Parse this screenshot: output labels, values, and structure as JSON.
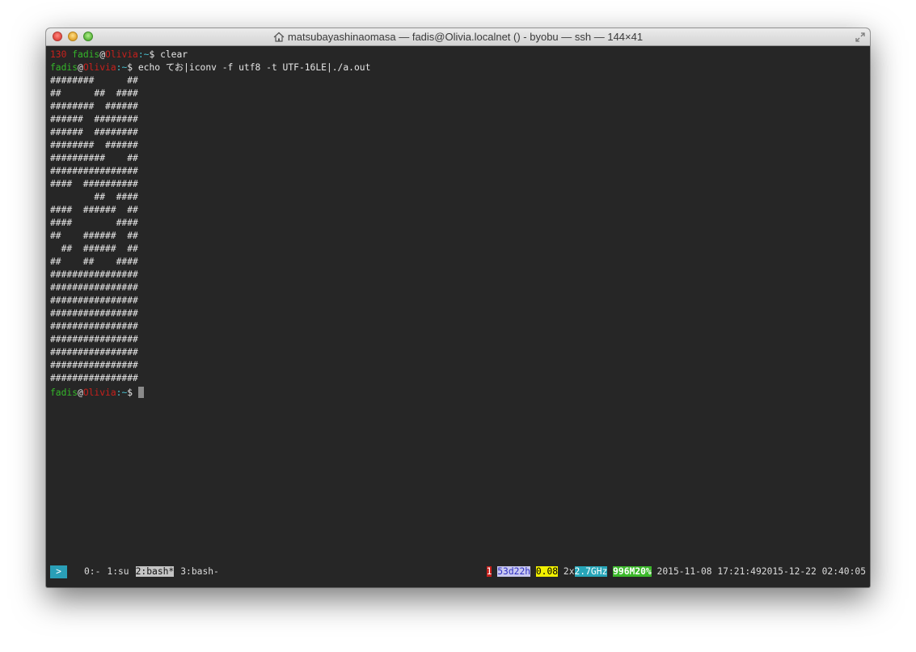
{
  "window": {
    "title": "matsubayashinaomasa — fadis@Olivia.localnet () - byobu — ssh — 144×41"
  },
  "terminal": {
    "line1": {
      "exit_code": "130",
      "user": "fadis",
      "at": "@",
      "host": "Olivia",
      "path": ":~",
      "sym": "$ ",
      "cmd": "clear"
    },
    "line2": {
      "user": "fadis",
      "at": "@",
      "host": "Olivia",
      "path": ":~",
      "sym": "$ ",
      "cmd": "echo てお|iconv -f utf8 -t UTF-16LE|./a.out"
    },
    "output": [
      "########      ##",
      "##      ##  ####",
      "########  ######",
      "######  ########",
      "######  ########",
      "########  ######",
      "##########    ##",
      "################",
      "####  ##########",
      "        ##  ####",
      "####  ######  ##",
      "####        ####",
      "##    ######  ##",
      "  ##  ######  ##",
      "##    ##    ####",
      "################",
      "################",
      "################",
      "################",
      "################",
      "################",
      "################",
      "################",
      "################"
    ],
    "prompt": {
      "user": "fadis",
      "at": "@",
      "host": "Olivia",
      "path": ":~",
      "sym": "$ "
    }
  },
  "statusbar": {
    "prompt_badge": ">",
    "windows": [
      "0:-",
      "1:su",
      "2:bash*",
      "3:bash-"
    ],
    "updates": "1",
    "uptime": "53d22h",
    "load": "0.08",
    "cpu_prefix": "2x",
    "cpu_speed": "2.7GHz",
    "memory": "996M20%",
    "datetime": "2015-11-08 17:21:492015-12-22 02:40:05"
  },
  "colors": {
    "terminal_bg": "#262626",
    "prompt_green": "#35b82a",
    "host_red": "#c9201c",
    "status_cyan": "#26a5b8"
  }
}
